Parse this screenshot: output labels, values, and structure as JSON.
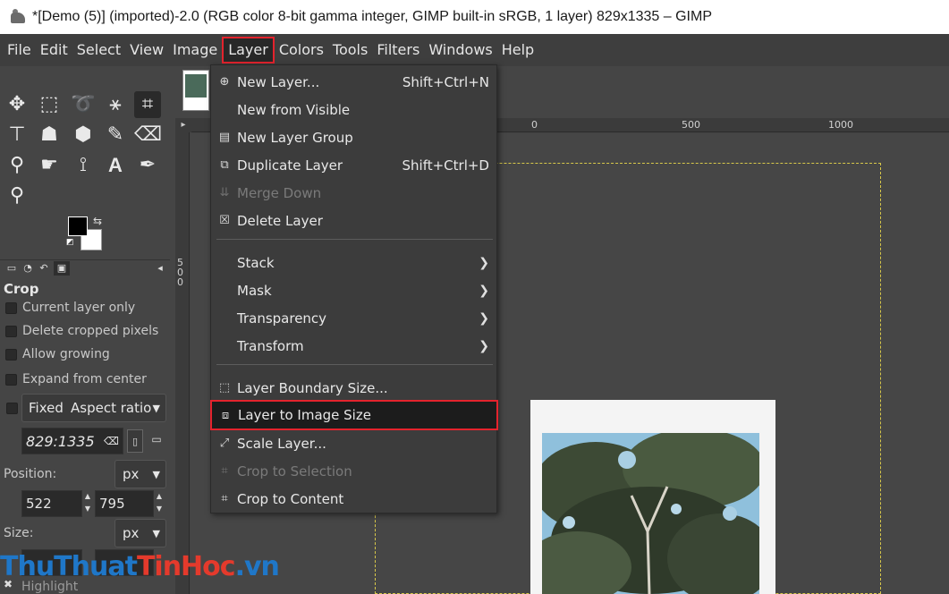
{
  "window": {
    "title": "*[Demo (5)] (imported)-2.0 (RGB color 8-bit gamma integer, GIMP built-in sRGB, 1 layer) 829x1335 – GIMP"
  },
  "menubar": {
    "items": [
      "File",
      "Edit",
      "Select",
      "View",
      "Image",
      "Layer",
      "Colors",
      "Tools",
      "Filters",
      "Windows",
      "Help"
    ],
    "active": "Layer"
  },
  "tool_options": {
    "title": "Crop",
    "current_layer_only": "Current layer only",
    "delete_cropped": "Delete cropped pixels",
    "allow_growing": "Allow growing",
    "expand_from_center": "Expand from center",
    "fixed_label": "Fixed",
    "fixed_mode": "Aspect ratio",
    "ratio_value": "829:1335",
    "position_label": "Position:",
    "position_unit": "px",
    "pos_x": "522",
    "pos_y": "795",
    "size_label": "Size:",
    "size_unit": "px",
    "highlight_label": "Highlight"
  },
  "rulers": {
    "top": [
      "0",
      "500",
      "1000"
    ],
    "left": "500"
  },
  "layer_menu": {
    "items": [
      {
        "label": "New Layer...",
        "accel": "Shift+Ctrl+N",
        "icon": "new-layer-icon"
      },
      {
        "label": "New from Visible",
        "icon": ""
      },
      {
        "label": "New Layer Group",
        "icon": "new-group-icon"
      },
      {
        "label": "Duplicate Layer",
        "accel": "Shift+Ctrl+D",
        "icon": "duplicate-icon"
      },
      {
        "label": "Merge Down",
        "icon": "merge-down-icon",
        "disabled": true
      },
      {
        "label": "Delete Layer",
        "icon": "delete-icon"
      },
      {
        "label": "Stack",
        "submenu": true
      },
      {
        "label": "Mask",
        "submenu": true
      },
      {
        "label": "Transparency",
        "submenu": true
      },
      {
        "label": "Transform",
        "submenu": true
      },
      {
        "label": "Layer Boundary Size...",
        "icon": "boundary-icon"
      },
      {
        "label": "Layer to Image Size",
        "icon": "layer-to-image-icon",
        "highlighted": true
      },
      {
        "label": "Scale Layer...",
        "icon": "scale-icon"
      },
      {
        "label": "Crop to Selection",
        "icon": "crop-selection-icon",
        "disabled": true
      },
      {
        "label": "Crop to Content",
        "icon": "crop-content-icon"
      }
    ]
  },
  "watermark": {
    "part1": "ThuThuat",
    "part2": "TinHoc",
    "part3": ".vn"
  },
  "colors": {
    "accent_red": "#e4232d",
    "menu_bg": "#3c3c3c",
    "ui_bg": "#454545"
  }
}
